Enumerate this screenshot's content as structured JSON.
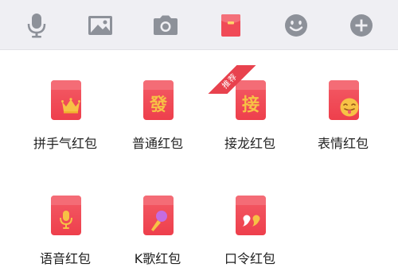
{
  "toolbar": {
    "items": [
      {
        "name": "microphone-icon",
        "color": "#8d9199"
      },
      {
        "name": "image-icon",
        "color": "#8d9199"
      },
      {
        "name": "camera-icon",
        "color": "#8d9199"
      },
      {
        "name": "red-packet-icon",
        "color": "#f04a57",
        "selected": true
      },
      {
        "name": "emoji-icon",
        "color": "#8d9199"
      },
      {
        "name": "plus-icon",
        "color": "#8d9199"
      }
    ]
  },
  "packets": {
    "items": [
      {
        "label": "拼手气红包",
        "icon": "crown-icon"
      },
      {
        "label": "普通红包",
        "icon": "fa-character-icon",
        "glyph": "發"
      },
      {
        "label": "接龙红包",
        "icon": "jie-character-icon",
        "glyph": "接",
        "badge": "推荐"
      },
      {
        "label": "表情红包",
        "icon": "tongue-emoji-icon"
      },
      {
        "label": "语音红包",
        "icon": "microphone-icon"
      },
      {
        "label": "K歌红包",
        "icon": "karaoke-mic-icon"
      },
      {
        "label": "口令红包",
        "icon": "quote-marks-icon"
      }
    ]
  },
  "colors": {
    "accent": "#ee3f4c",
    "gold": "#f7c245",
    "toolbar_bg": "#efeff3"
  }
}
